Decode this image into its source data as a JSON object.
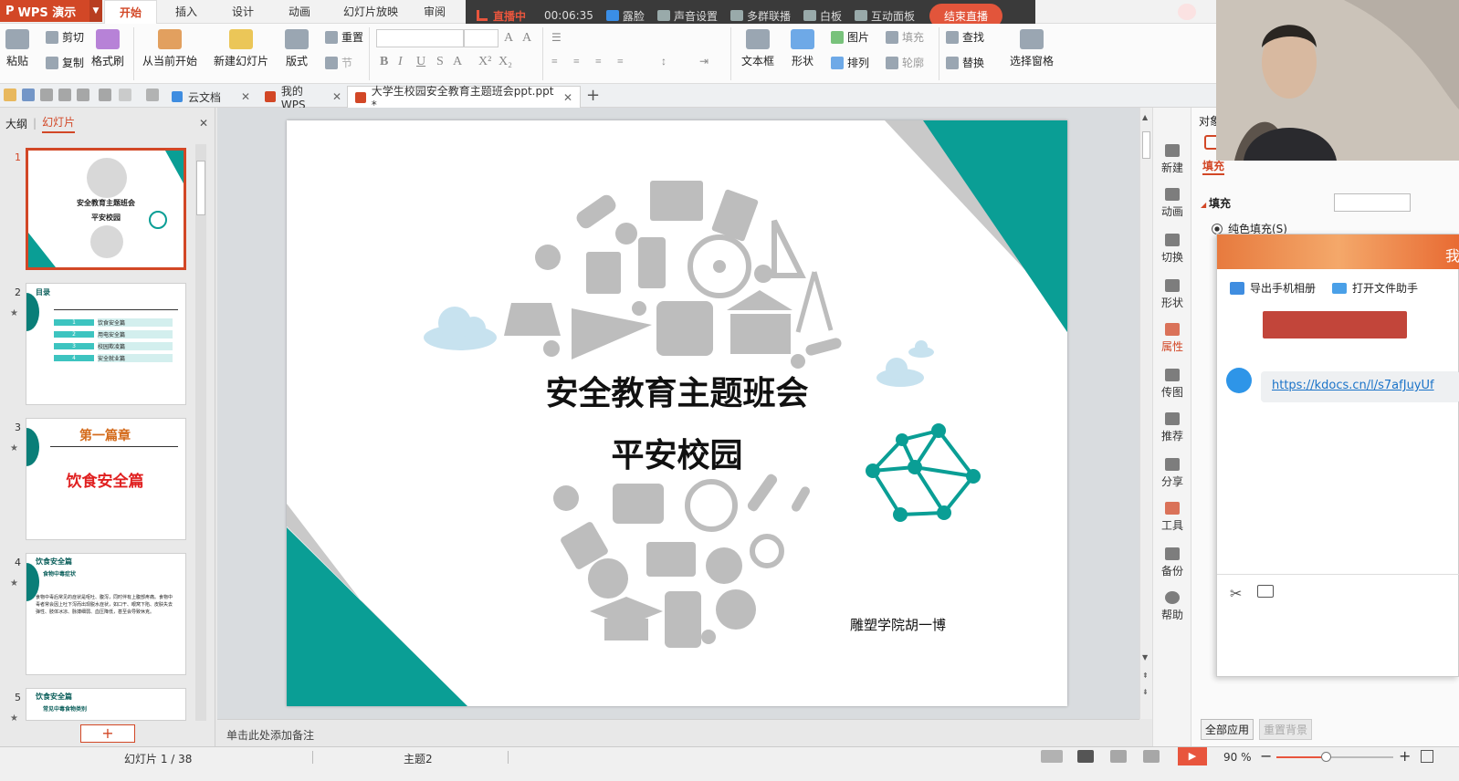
{
  "app": {
    "name": "WPS 演示"
  },
  "ribbon_tabs": [
    "开始",
    "插入",
    "设计",
    "动画",
    "幻灯片放映",
    "审阅"
  ],
  "live": {
    "status": "直播中",
    "timer": "00:06:35",
    "items": [
      "露脸",
      "声音设置",
      "多群联播",
      "白板",
      "互动面板"
    ],
    "end_button": "结束直播"
  },
  "ribbon": {
    "paste": "粘贴",
    "cut": "剪切",
    "copy": "复制",
    "format_painter": "格式刷",
    "from_current": "从当前开始",
    "new_slide": "新建幻灯片",
    "layout": "版式",
    "reset": "重置",
    "section": "节",
    "textbox": "文本框",
    "shape": "形状",
    "arrange": "排列",
    "picture": "图片",
    "fill": "填充",
    "outline": "轮廓",
    "find": "查找",
    "replace": "替换",
    "selection_pane": "选择窗格"
  },
  "doc_tabs": [
    {
      "label": "云文档",
      "color": "#3f8de0"
    },
    {
      "label": "我的WPS",
      "color": "#d24726"
    },
    {
      "label": "大学生校园安全教育主题班会ppt.ppt *",
      "color": "#d24726"
    }
  ],
  "left_pane": {
    "outline_label": "大纲",
    "slides_label": "幻灯片"
  },
  "thumbnails": [
    {
      "num": "1",
      "title": "安全教育主题班会",
      "sub": "平安校园"
    },
    {
      "num": "2",
      "heading": "目录",
      "items": [
        "饮食安全篇",
        "用电安全篇",
        "校园欺凌篇",
        "安全就业篇"
      ]
    },
    {
      "num": "3",
      "chapter": "第一篇章",
      "title": "饮食安全篇"
    },
    {
      "num": "4",
      "heading": "饮食安全篇",
      "sub": "食物中毒症状",
      "body": "食物中毒后常见的症状是呕吐、腹泻，同时伴有上腹部疼痛。食物中毒者常会因上吐下泻而出现脱水症状，如口干、眼窝下陷、皮肤失去弹性、肢体冰凉、脉搏细弱、血压降低，甚至会导致休克。"
    },
    {
      "num": "5",
      "heading": "饮食安全篇",
      "sub": "常见中毒食物类别"
    }
  ],
  "slide": {
    "title": "安全教育主题班会",
    "subtitle": "平安校园",
    "author": "雕塑学院胡一博",
    "teal": "#0a9e95",
    "gray": "#c0c0c0"
  },
  "notes_placeholder": "单击此处添加备注",
  "rail": [
    "新建",
    "动画",
    "切换",
    "形状",
    "属性",
    "传图",
    "推荐",
    "分享",
    "工具",
    "备份",
    "帮助"
  ],
  "props": {
    "tab_object": "对象",
    "tab_fill": "填充",
    "section_fill": "填充",
    "solid_fill": "纯色填充(S)",
    "apply_all": "全部应用",
    "reset_bg": "重置背景"
  },
  "popup": {
    "title": "我",
    "export_photos": "导出手机相册",
    "open_helper": "打开文件助手",
    "link": "https://kdocs.cn/l/s7afJuyUf"
  },
  "status": {
    "slide_counter": "幻灯片 1 / 38",
    "theme": "主题2",
    "zoom": "90 %",
    "zoom_fraction": 0.42
  }
}
